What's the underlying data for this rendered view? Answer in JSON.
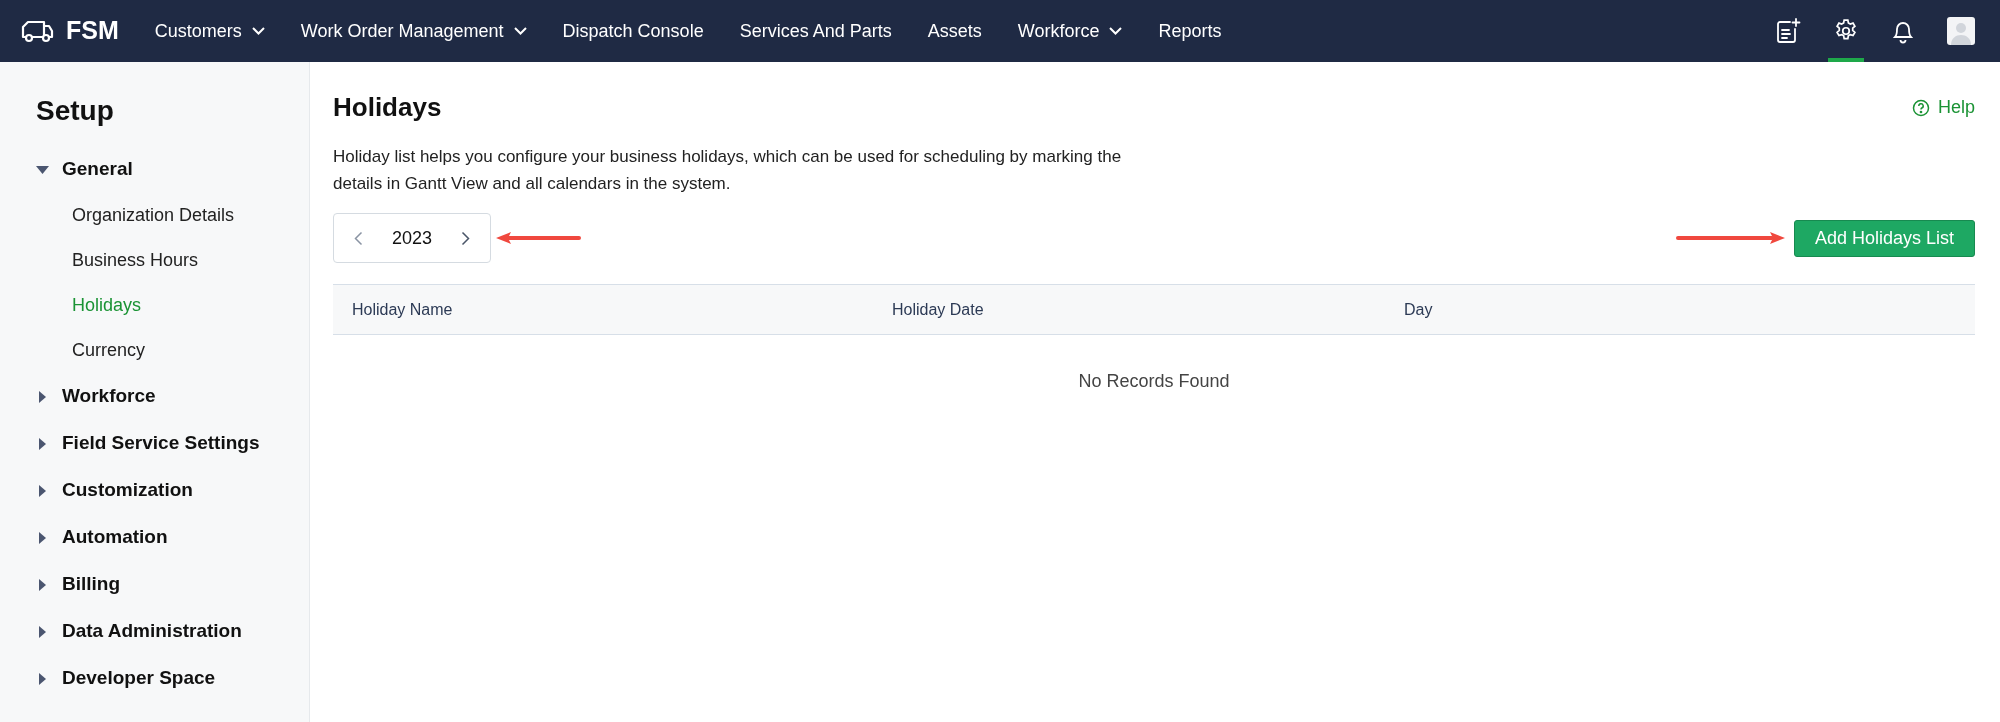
{
  "app": {
    "name": "FSM"
  },
  "nav": [
    {
      "label": "Customers",
      "dropdown": true
    },
    {
      "label": "Work Order Management",
      "dropdown": true
    },
    {
      "label": "Dispatch Console",
      "dropdown": false
    },
    {
      "label": "Services And Parts",
      "dropdown": false
    },
    {
      "label": "Assets",
      "dropdown": false
    },
    {
      "label": "Workforce",
      "dropdown": true
    },
    {
      "label": "Reports",
      "dropdown": false
    }
  ],
  "toolbar": [
    {
      "kind": "new-note",
      "selected": false
    },
    {
      "kind": "settings",
      "selected": true
    },
    {
      "kind": "notifications",
      "selected": false
    },
    {
      "kind": "avatar",
      "selected": false
    }
  ],
  "sidebar": {
    "title": "Setup",
    "sections": [
      {
        "label": "General",
        "expanded": true,
        "children": [
          {
            "label": "Organization Details",
            "selected": false
          },
          {
            "label": "Business Hours",
            "selected": false
          },
          {
            "label": "Holidays",
            "selected": true
          },
          {
            "label": "Currency",
            "selected": false
          }
        ]
      },
      {
        "label": "Workforce",
        "expanded": false
      },
      {
        "label": "Field Service Settings",
        "expanded": false
      },
      {
        "label": "Customization",
        "expanded": false
      },
      {
        "label": "Automation",
        "expanded": false
      },
      {
        "label": "Billing",
        "expanded": false
      },
      {
        "label": "Data Administration",
        "expanded": false
      },
      {
        "label": "Developer Space",
        "expanded": false
      }
    ]
  },
  "page": {
    "title": "Holidays",
    "help": "Help",
    "description": "Holiday list helps you configure your business holidays, which can be used for scheduling by marking the details in Gantt View and all calendars in the system.",
    "year": "2023",
    "add_button": "Add Holidays List"
  },
  "table": {
    "columns": [
      "Holiday Name",
      "Holiday Date",
      "Day"
    ],
    "empty_message": "No Records Found"
  }
}
